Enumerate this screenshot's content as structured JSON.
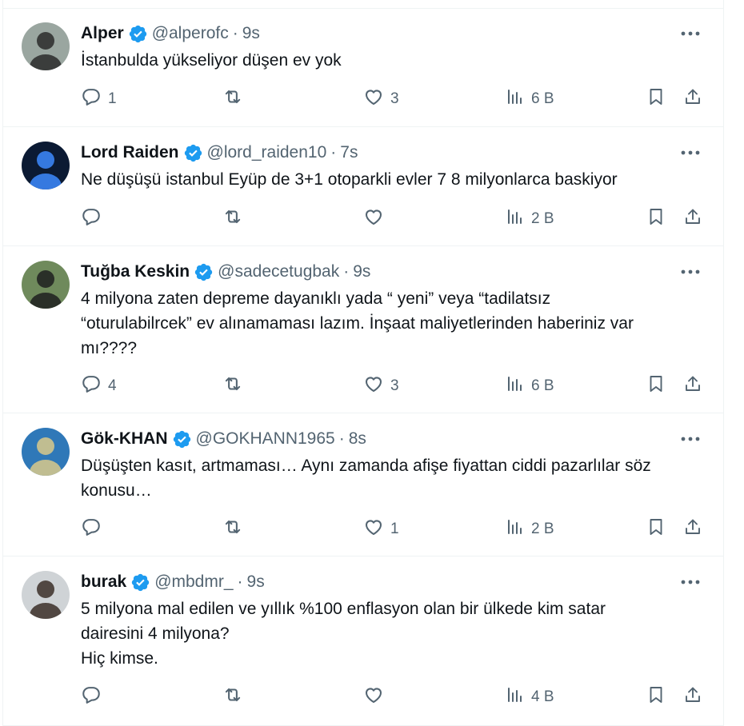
{
  "tweets": [
    {
      "name": "Alper",
      "handle": "@alperofc",
      "time": "9s",
      "lines": [
        "İstanbulda yükseliyor düşen ev yok"
      ],
      "replies": "1",
      "retweets": "",
      "likes": "3",
      "views": "6 B",
      "avatar_colors": [
        "#9aa6a0",
        "#2a2a2a"
      ]
    },
    {
      "name": "Lord Raiden",
      "handle": "@lord_raiden10",
      "time": "7s",
      "lines": [
        "Ne düşüşü istanbul Eyüp de 3+1 otoparkli evler 7 8 milyonlarca baskiyor"
      ],
      "replies": "",
      "retweets": "",
      "likes": "",
      "views": "2 B",
      "avatar_colors": [
        "#0b1a33",
        "#3d8bff"
      ]
    },
    {
      "name": "Tuğba Keskin",
      "handle": "@sadecetugbak",
      "time": "9s",
      "lines": [
        "4 milyona zaten depreme dayanıklı yada “ yeni” veya “tadilatsız",
        "“oturulabilrcek” ev alınamaması lazım. İnşaat maliyetlerinden haberiniz var",
        "mı????"
      ],
      "replies": "4",
      "retweets": "",
      "likes": "3",
      "views": "6 B",
      "avatar_colors": [
        "#6f8a5c",
        "#1e1e1e"
      ]
    },
    {
      "name": "Gök-KHAN",
      "handle": "@GOKHANN1965",
      "time": "8s",
      "lines": [
        "Düşüşten kasıt, artmaması… Aynı zamanda afişe fiyattan ciddi pazarlılar söz",
        "konusu…"
      ],
      "replies": "",
      "retweets": "",
      "likes": "1",
      "views": "2 B",
      "avatar_colors": [
        "#2f78b8",
        "#d9c98a"
      ]
    },
    {
      "name": "burak",
      "handle": "@mbdmr_",
      "time": "9s",
      "lines": [
        "5 milyona mal edilen ve yıllık %100 enflasyon olan bir ülkede kim satar",
        "dairesini 4 milyona?",
        "Hiç kimse."
      ],
      "replies": "",
      "retweets": "",
      "likes": "",
      "views": "4 B",
      "avatar_colors": [
        "#cfd3d6",
        "#3b2e28"
      ]
    }
  ],
  "colors": {
    "text": "#0f1419",
    "muted": "#536471",
    "verified": "#1d9bf0",
    "divider": "#eff3f4"
  },
  "icons": [
    "verified-badge-icon",
    "more-icon",
    "reply-icon",
    "retweet-icon",
    "like-icon",
    "views-icon",
    "bookmark-icon",
    "share-icon"
  ]
}
